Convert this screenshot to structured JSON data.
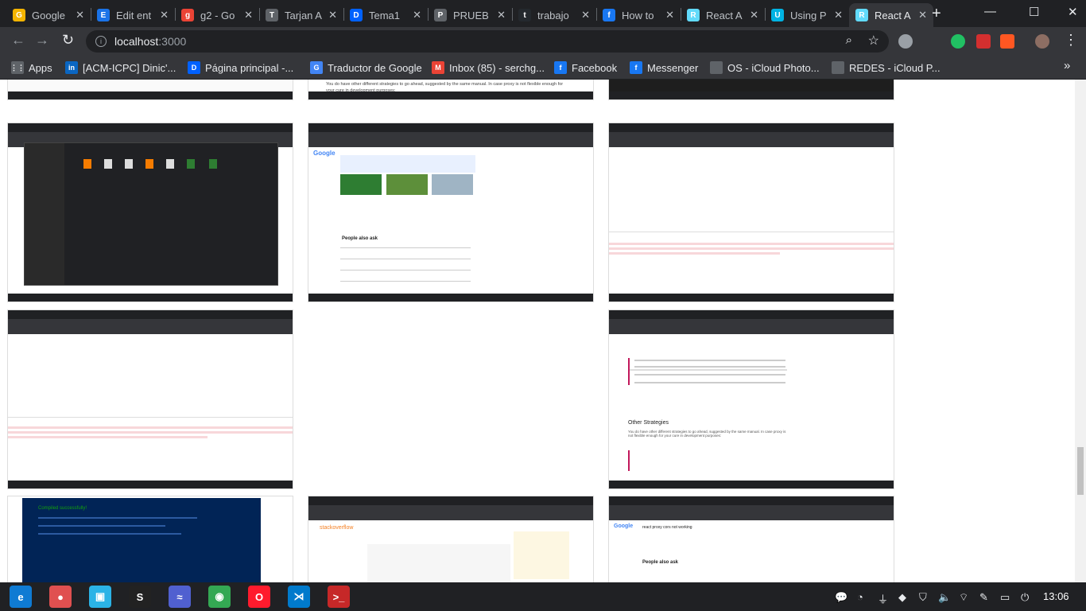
{
  "browser": {
    "tabs": [
      {
        "title": "Google",
        "color": "#f4b400",
        "glyph": "G"
      },
      {
        "title": "Edit ent",
        "color": "#1a73e8",
        "glyph": "E"
      },
      {
        "title": "g2 - Go",
        "color": "#ea4335",
        "glyph": "g"
      },
      {
        "title": "Tarjan A",
        "color": "#5f6368",
        "glyph": "T"
      },
      {
        "title": "Tema1",
        "color": "#0061ff",
        "glyph": "D"
      },
      {
        "title": "PRUEB",
        "color": "#5f6368",
        "glyph": "P"
      },
      {
        "title": "trabajo",
        "color": "#24292e",
        "glyph": "t"
      },
      {
        "title": "How to",
        "color": "#1877f2",
        "glyph": "f"
      },
      {
        "title": "React A",
        "color": "#61dafb",
        "glyph": "R"
      },
      {
        "title": "Using P",
        "color": "#00b3e3",
        "glyph": "U"
      },
      {
        "title": "React A",
        "color": "#61dafb",
        "glyph": "R"
      }
    ],
    "active_tab_index": 10,
    "new_tab": "+",
    "window": {
      "minimize": "—",
      "maximize": "☐",
      "close": "✕"
    },
    "url": {
      "host": "localhost",
      "port": ":3000"
    },
    "bookmarks": [
      {
        "label": "Apps",
        "color": "#5f6368",
        "glyph": "⋮⋮"
      },
      {
        "label": "[ACM-ICPC] Dinic'...",
        "color": "#0a66c2",
        "glyph": "in"
      },
      {
        "label": "Página principal -...",
        "color": "#0061ff",
        "glyph": "D"
      },
      {
        "label": "Traductor de Google",
        "color": "#4285f4",
        "glyph": "G"
      },
      {
        "label": "Inbox (85) - serchg...",
        "color": "#ea4335",
        "glyph": "M"
      },
      {
        "label": "Facebook",
        "color": "#1877f2",
        "glyph": "f"
      },
      {
        "label": "Messenger",
        "color": "#1877f2",
        "glyph": "f"
      },
      {
        "label": "OS - iCloud Photo...",
        "color": "#5f6368",
        "glyph": ""
      },
      {
        "label": "REDES - iCloud P...",
        "color": "#5f6368",
        "glyph": ""
      }
    ],
    "bookmarks_overflow": "»"
  },
  "page": {
    "snippets": {
      "strategies": "You do have other different strategies to go ahead, suggested by the same manual. In case proxy is not flexible enough for your cure in development purposes:",
      "people_also_ask": "People also ask",
      "other_strategies": "Other Strategies",
      "compiled": "Compiled successfully!",
      "stackoverflow": "stackoverflow",
      "google_query": "react proxy cors not working"
    }
  },
  "taskbar": {
    "clock": "13:06",
    "apps": [
      {
        "name": "edge",
        "color": "#0f7bd3",
        "glyph": "e"
      },
      {
        "name": "recorder",
        "color": "#e05050",
        "glyph": "●"
      },
      {
        "name": "store",
        "color": "#2bb3e6",
        "glyph": "▣"
      },
      {
        "name": "steam",
        "color": "#222",
        "glyph": "S"
      },
      {
        "name": "monitor",
        "color": "#5060d0",
        "glyph": "≈"
      },
      {
        "name": "chrome",
        "color": "#34a853",
        "glyph": "◉"
      },
      {
        "name": "opera",
        "color": "#ff1b2d",
        "glyph": "O"
      },
      {
        "name": "vscode",
        "color": "#007acc",
        "glyph": "⋊"
      },
      {
        "name": "terminal",
        "color": "#c62828",
        "glyph": ">_"
      }
    ]
  }
}
